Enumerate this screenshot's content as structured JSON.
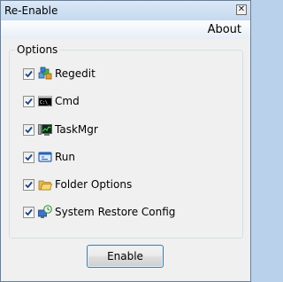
{
  "window": {
    "title": "Re-Enable",
    "close_glyph": "✕"
  },
  "menu": {
    "about": "About"
  },
  "group": {
    "label": "Options"
  },
  "options": [
    {
      "label": "Regedit",
      "checked": true,
      "icon": "regedit-icon"
    },
    {
      "label": "Cmd",
      "checked": true,
      "icon": "cmd-icon"
    },
    {
      "label": "TaskMgr",
      "checked": true,
      "icon": "taskmgr-icon"
    },
    {
      "label": "Run",
      "checked": true,
      "icon": "run-icon"
    },
    {
      "label": "Folder Options",
      "checked": true,
      "icon": "folder-icon"
    },
    {
      "label": "System Restore Config",
      "checked": true,
      "icon": "system-restore-icon"
    }
  ],
  "buttons": {
    "enable": "Enable"
  },
  "colors": {
    "accent": "#3c7fb1",
    "check": "#1e3f8a"
  }
}
